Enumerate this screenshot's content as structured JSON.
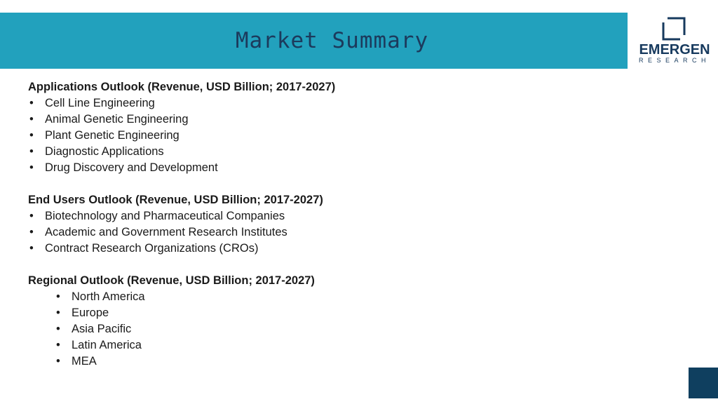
{
  "header": {
    "title": "Market Summary"
  },
  "logo": {
    "brand": "EMERGEN",
    "sub": "RESEARCH"
  },
  "sections": [
    {
      "heading": "Applications Outlook (Revenue, USD Billion; 2017-2027)",
      "items": [
        "Cell Line Engineering",
        "Animal Genetic Engineering",
        "Plant Genetic Engineering",
        "Diagnostic Applications",
        "Drug Discovery and Development"
      ]
    },
    {
      "heading": "End Users Outlook (Revenue, USD Billion; 2017-2027)",
      "items": [
        "Biotechnology and Pharmaceutical Companies",
        "Academic and Government Research Institutes",
        "Contract Research Organizations (CROs)"
      ]
    },
    {
      "heading": "Regional Outlook (Revenue, USD Billion; 2017-2027)",
      "items": [
        "North America",
        "Europe",
        "Asia Pacific",
        "Latin America",
        "MEA"
      ]
    }
  ],
  "colors": {
    "header_band": "#22a1bd",
    "title_text": "#1c3a5c",
    "logo": "#173a5e",
    "corner_box": "#0f3f5f"
  }
}
